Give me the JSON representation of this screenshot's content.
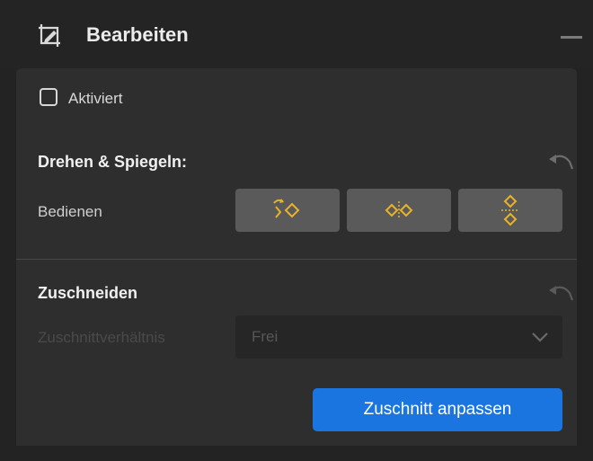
{
  "header": {
    "title": "Bearbeiten",
    "icon": "edit-crop-icon"
  },
  "activation": {
    "label": "Aktiviert",
    "checked": false
  },
  "rotate_section": {
    "title": "Drehen & Spiegeln:",
    "row_label": "Bedienen",
    "buttons": [
      {
        "icon": "rotate-icon"
      },
      {
        "icon": "flip-horizontal-icon"
      },
      {
        "icon": "flip-vertical-icon"
      }
    ],
    "icon_color": "#e8b32a"
  },
  "crop_section": {
    "title": "Zuschneiden",
    "ratio_label": "Zuschnittverhältnis",
    "ratio_value": "Frei",
    "apply_label": "Zuschnitt anpassen"
  },
  "colors": {
    "accent": "#1b75e0",
    "panel": "#2e2e2e"
  }
}
